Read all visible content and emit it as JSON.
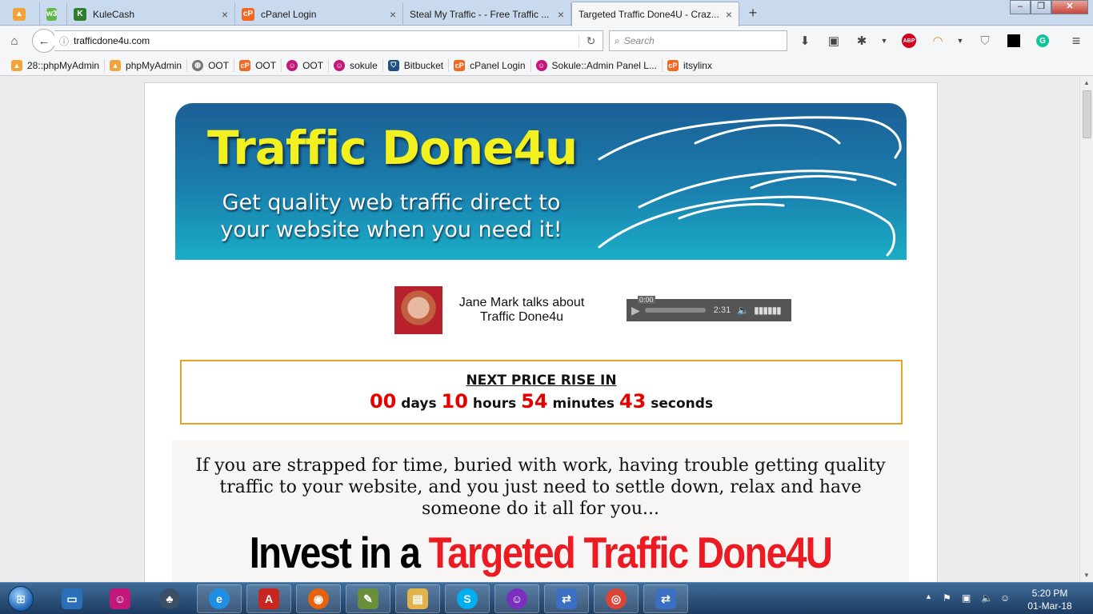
{
  "browser": {
    "tabs": [
      {
        "label": "",
        "icon": "phpmyadmin-icon",
        "active": false
      },
      {
        "label": "",
        "icon": "w3-icon",
        "active": false
      },
      {
        "label": "KuleCash",
        "icon": "kulecash-icon",
        "active": false
      },
      {
        "label": "cPanel Login",
        "icon": "cpanel-icon",
        "active": false
      },
      {
        "label": "Steal My Traffic - - Free Traffic ...",
        "icon": "",
        "active": false
      },
      {
        "label": "Targeted Traffic Done4U - Craz...",
        "icon": "",
        "active": true
      }
    ],
    "new_tab": "+",
    "url": "trafficdone4u.com",
    "search_placeholder": "Search",
    "bookmarks": [
      {
        "label": "28::phpMyAdmin",
        "icon": "phpmyadmin-icon"
      },
      {
        "label": "phpMyAdmin",
        "icon": "phpmyadmin-icon"
      },
      {
        "label": "OOT",
        "icon": "globe-icon"
      },
      {
        "label": "OOT",
        "icon": "cpanel-icon"
      },
      {
        "label": "OOT",
        "icon": "smiley-icon"
      },
      {
        "label": "sokule",
        "icon": "smiley-icon"
      },
      {
        "label": "Bitbucket",
        "icon": "bitbucket-icon"
      },
      {
        "label": "cPanel Login",
        "icon": "cpanel-icon"
      },
      {
        "label": "Sokule::Admin Panel L...",
        "icon": "smiley-icon"
      },
      {
        "label": "itsylinx",
        "icon": "cpanel-icon"
      }
    ],
    "toolbar_badges": {
      "adblock": "ABP"
    }
  },
  "page": {
    "banner": {
      "title": "Traffic Done4u",
      "subtitle": "Get quality web traffic direct to your website when you need it!"
    },
    "audio": {
      "label": "Jane Mark talks about Traffic Done4u",
      "current_time": "0:00",
      "duration": "2:31"
    },
    "countdown": {
      "heading": "NEXT PRICE RISE IN",
      "days": "00",
      "days_label": "days",
      "hours": "10",
      "hours_label": "hours",
      "minutes": "54",
      "minutes_label": "minutes",
      "seconds": "43",
      "seconds_label": "seconds"
    },
    "pitch": {
      "intro": "If you are strapped for time, buried with work, having trouble getting quality traffic to your website, and you just need to settle down, relax and have someone do it all for you...",
      "headline_black": "Invest in a",
      "headline_red": "Targeted Traffic Done4U"
    }
  },
  "taskbar": {
    "clock_time": "5:20 PM",
    "clock_date": "01-Mar-18"
  },
  "colors": {
    "accent_red": "#ec1b23",
    "countdown_border": "#f0a020",
    "banner_title": "#f2f01f"
  }
}
